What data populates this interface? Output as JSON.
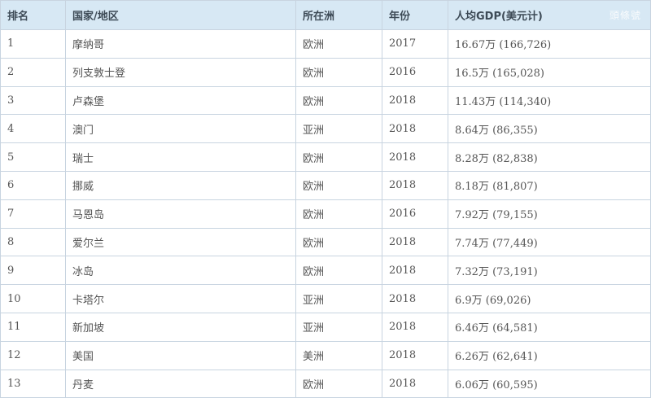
{
  "header": {
    "rank": "排名",
    "country": "国家/地区",
    "continent": "所在洲",
    "year": "年份",
    "gdp": "人均GDP(美元计)",
    "watermark": "頭條號"
  },
  "rows": [
    {
      "rank": "1",
      "country": "摩纳哥",
      "continent": "欧洲",
      "year": "2017",
      "gdp": "16.67万 (166,726)"
    },
    {
      "rank": "2",
      "country": "列支敦士登",
      "continent": "欧洲",
      "year": "2016",
      "gdp": "16.5万 (165,028)"
    },
    {
      "rank": "3",
      "country": "卢森堡",
      "continent": "欧洲",
      "year": "2018",
      "gdp": "11.43万 (114,340)"
    },
    {
      "rank": "4",
      "country": "澳门",
      "continent": "亚洲",
      "year": "2018",
      "gdp": "8.64万 (86,355)"
    },
    {
      "rank": "5",
      "country": "瑞士",
      "continent": "欧洲",
      "year": "2018",
      "gdp": "8.28万 (82,838)"
    },
    {
      "rank": "6",
      "country": "挪威",
      "continent": "欧洲",
      "year": "2018",
      "gdp": "8.18万 (81,807)"
    },
    {
      "rank": "7",
      "country": "马恩岛",
      "continent": "欧洲",
      "year": "2016",
      "gdp": "7.92万 (79,155)"
    },
    {
      "rank": "8",
      "country": "爱尔兰",
      "continent": "欧洲",
      "year": "2018",
      "gdp": "7.74万 (77,449)"
    },
    {
      "rank": "9",
      "country": "冰岛",
      "continent": "欧洲",
      "year": "2018",
      "gdp": "7.32万 (73,191)"
    },
    {
      "rank": "10",
      "country": "卡塔尔",
      "continent": "亚洲",
      "year": "2018",
      "gdp": "6.9万 (69,026)"
    },
    {
      "rank": "11",
      "country": "新加坡",
      "continent": "亚洲",
      "year": "2018",
      "gdp": "6.46万 (64,581)"
    },
    {
      "rank": "12",
      "country": "美国",
      "continent": "美洲",
      "year": "2018",
      "gdp": "6.26万 (62,641)"
    },
    {
      "rank": "13",
      "country": "丹麦",
      "continent": "欧洲",
      "year": "2018",
      "gdp": "6.06万 (60,595)"
    }
  ],
  "colors": {
    "header_bg": "#d7e8f4",
    "border": "#c8d4e0",
    "text": "#555555"
  }
}
